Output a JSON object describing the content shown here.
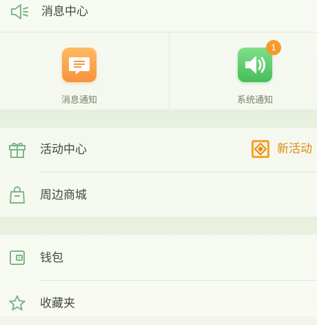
{
  "header": {
    "title": "消息中心"
  },
  "notifications": [
    {
      "label": "消息通知",
      "icon": "message-icon",
      "color": "#f7943a"
    },
    {
      "label": "系统通知",
      "icon": "speaker-icon",
      "color": "#46bd5a",
      "badge": "1"
    }
  ],
  "menu": {
    "activity": {
      "label": "活动中心",
      "new_label": "新活动",
      "icon": "gift-icon"
    },
    "mall": {
      "label": "周边商城",
      "icon": "shopping-bag-icon"
    },
    "wallet": {
      "label": "钱包",
      "icon": "wallet-icon"
    },
    "favorites": {
      "label": "收藏夹",
      "icon": "star-icon"
    }
  },
  "colors": {
    "accent": "#e28a14",
    "icon_green": "#7cb58a",
    "background": "#f1f6e9"
  }
}
